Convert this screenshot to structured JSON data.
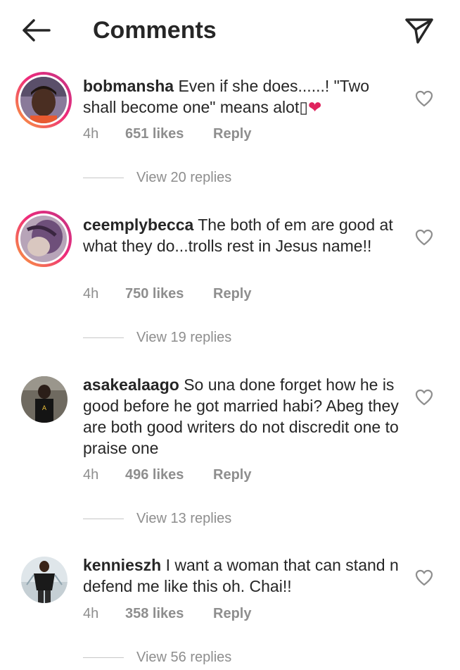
{
  "header": {
    "title": "Comments",
    "back_icon": "arrow-left-icon",
    "share_icon": "paper-plane-icon"
  },
  "colors": {
    "text": "#262626",
    "secondary": "#8e8e8e",
    "heart": "#e0245e"
  },
  "comments": [
    {
      "username": "bobmansha",
      "text": " Even if she does......! \"Two shall become one\" means alot▯",
      "emoji": "❤",
      "time": "4h",
      "likes": "651 likes",
      "reply": "Reply",
      "view_replies": "View 20 replies"
    },
    {
      "username": "ceemplybecca",
      "text": " The both of em are good at what they do...trolls rest in Jesus name!!",
      "time": "4h",
      "likes": "750 likes",
      "reply": "Reply",
      "view_replies": "View 19 replies"
    },
    {
      "username": "asakealaago",
      "text": " So una done forget how he is good before he got married habi? Abeg they are both good writers do not discredit one to praise one",
      "time": "4h",
      "likes": "496 likes",
      "reply": "Reply",
      "view_replies": "View 13 replies"
    },
    {
      "username": "kennieszh",
      "text": " I want a woman that can stand n defend me like this oh. Chai!!",
      "time": "4h",
      "likes": "358 likes",
      "reply": "Reply",
      "view_replies": "View 56 replies"
    }
  ]
}
